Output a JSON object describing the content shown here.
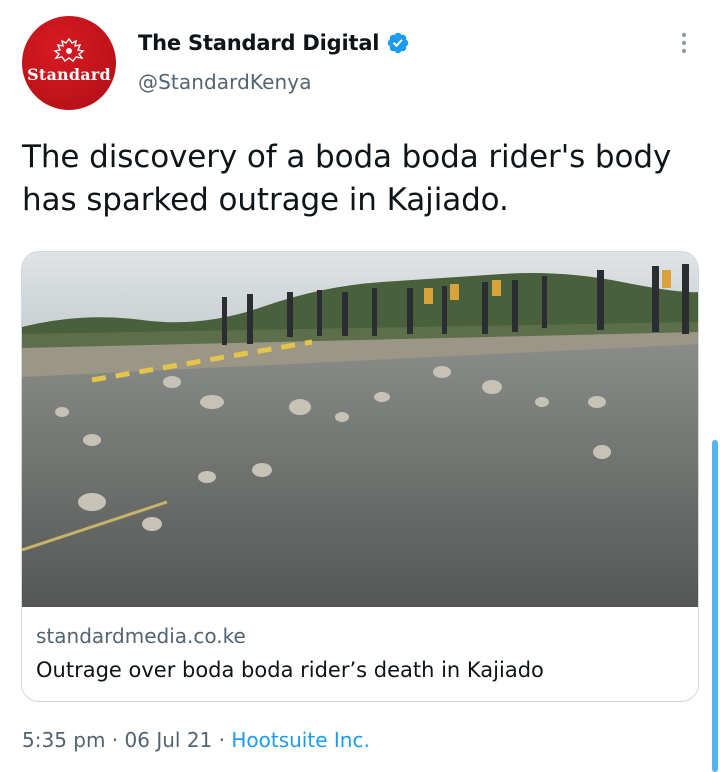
{
  "author": {
    "name": "The Standard Digital",
    "handle": "@StandardKenya",
    "avatar_wordmark": "Standard",
    "verified": true
  },
  "tweet": {
    "text": "The discovery of a boda boda rider's body has sparked outrage in Kajiado."
  },
  "card": {
    "domain": "standardmedia.co.ke",
    "title": "Outrage over boda boda rider’s death in Kajiado",
    "image_icon": "road-with-scattered-rocks-photo"
  },
  "meta": {
    "time": "5:35 pm",
    "separator": " · ",
    "date": "06 Jul 21",
    "source": "Hootsuite Inc."
  },
  "colors": {
    "link_blue": "#1d9bf0",
    "secondary_text": "#536471",
    "brand_red": "#c0131a"
  }
}
